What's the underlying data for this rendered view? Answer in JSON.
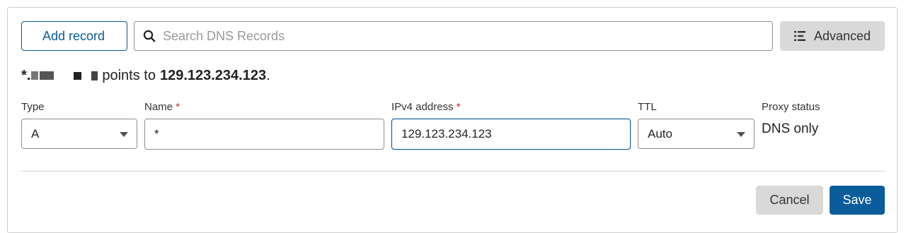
{
  "toolbar": {
    "add_record_label": "Add record",
    "search_placeholder": "Search DNS Records",
    "search_value": "",
    "advanced_label": "Advanced"
  },
  "hint": {
    "prefix": "*.",
    "middle": "points to",
    "target": "129.123.234.123",
    "suffix": "."
  },
  "form": {
    "type": {
      "label": "Type",
      "value": "A"
    },
    "name": {
      "label": "Name",
      "required_mark": "*",
      "value": "*"
    },
    "ipv4": {
      "label": "IPv4 address",
      "required_mark": "*",
      "value": "129.123.234.123"
    },
    "ttl": {
      "label": "TTL",
      "value": "Auto"
    },
    "proxy": {
      "label": "Proxy status",
      "value": "DNS only"
    }
  },
  "actions": {
    "cancel_label": "Cancel",
    "save_label": "Save"
  },
  "colors": {
    "accent": "#0a5c9b",
    "required": "#c62828",
    "secondary_button": "#d9d9d9"
  },
  "icons": {
    "search": "search-icon",
    "advanced": "filter-list-icon",
    "dropdown": "chevron-down-icon"
  }
}
